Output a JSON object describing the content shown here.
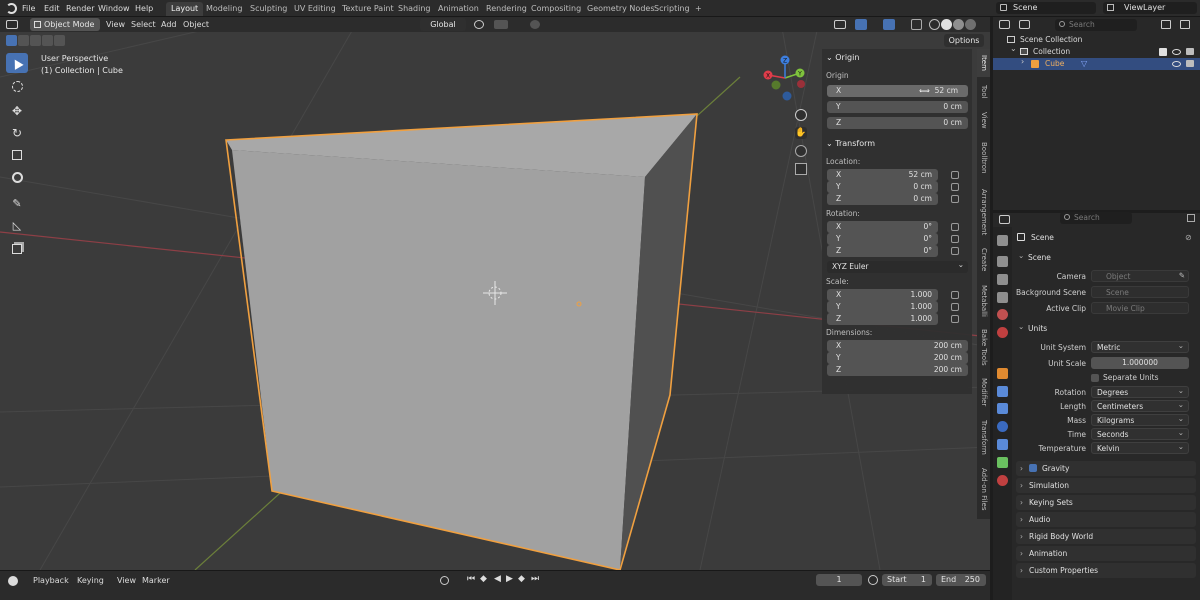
{
  "menubar": {
    "items": [
      "File",
      "Edit",
      "Render",
      "Window",
      "Help"
    ],
    "workspaces": [
      "Layout",
      "Modeling",
      "Sculpting",
      "UV Editing",
      "Texture Paint",
      "Shading",
      "Animation",
      "Rendering",
      "Compositing",
      "Geometry Nodes",
      "Scripting"
    ],
    "active_workspace": "Layout",
    "add_tab": "+",
    "scene_name": "Scene",
    "view_layer": "ViewLayer"
  },
  "viewport_header": {
    "mode": "Object Mode",
    "menus": [
      "View",
      "Select",
      "Add",
      "Object"
    ],
    "orientation": "Global",
    "options_label": "Options"
  },
  "viewport": {
    "perspective": "User Perspective",
    "collection_info": "(1) Collection | Cube",
    "object_color": "#b0b0b0",
    "selection_color": "#f0a040",
    "gizmo": {
      "x_color": "#e03c4a",
      "y_color": "#7fc33d",
      "z_color": "#3d7fe0",
      "labels": [
        "X",
        "Y",
        "Z"
      ]
    }
  },
  "npanel": {
    "origin": {
      "header": "Origin",
      "label": "Origin",
      "x": {
        "axis": "X",
        "value": "52 cm"
      },
      "y": {
        "axis": "Y",
        "value": "0 cm"
      },
      "z": {
        "axis": "Z",
        "value": "0 cm"
      }
    },
    "transform": {
      "header": "Transform",
      "location_label": "Location:",
      "location": [
        {
          "axis": "X",
          "value": "52 cm"
        },
        {
          "axis": "Y",
          "value": "0 cm"
        },
        {
          "axis": "Z",
          "value": "0 cm"
        }
      ],
      "rotation_label": "Rotation:",
      "rotation": [
        {
          "axis": "X",
          "value": "0°"
        },
        {
          "axis": "Y",
          "value": "0°"
        },
        {
          "axis": "Z",
          "value": "0°"
        }
      ],
      "rotation_mode": "XYZ Euler",
      "scale_label": "Scale:",
      "scale": [
        {
          "axis": "X",
          "value": "1.000"
        },
        {
          "axis": "Y",
          "value": "1.000"
        },
        {
          "axis": "Z",
          "value": "1.000"
        }
      ],
      "dimensions_label": "Dimensions:",
      "dimensions": [
        {
          "axis": "X",
          "value": "200 cm"
        },
        {
          "axis": "Y",
          "value": "200 cm"
        },
        {
          "axis": "Z",
          "value": "200 cm"
        }
      ]
    },
    "tabs": [
      "Item",
      "Tool",
      "View",
      "Boolltron",
      "Arrangement",
      "Create",
      "Metaballi",
      "Bake Tools",
      "Modifier",
      "Transform",
      "Add-on Files"
    ]
  },
  "timeline": {
    "menus": [
      "Playback",
      "Keying",
      "View",
      "Marker"
    ],
    "current_frame": "1",
    "start_label": "Start",
    "start": "1",
    "end_label": "End",
    "end": "250"
  },
  "outliner": {
    "search_placeholder": "Search",
    "scene_collection": "Scene Collection",
    "collection": "Collection",
    "object": "Cube"
  },
  "properties": {
    "search_placeholder": "Search",
    "context": "Scene",
    "scene_section": "Scene",
    "camera_label": "Camera",
    "camera_placeholder": "Object",
    "bg_scene_label": "Background Scene",
    "bg_scene_placeholder": "Scene",
    "active_clip_label": "Active Clip",
    "active_clip_placeholder": "Movie Clip",
    "units_section": "Units",
    "unit_system_label": "Unit System",
    "unit_system": "Metric",
    "unit_scale_label": "Unit Scale",
    "unit_scale": "1.000000",
    "separate_units": "Separate Units",
    "rotation_label": "Rotation",
    "rotation": "Degrees",
    "length_label": "Length",
    "length": "Centimeters",
    "mass_label": "Mass",
    "mass": "Kilograms",
    "time_label": "Time",
    "time": "Seconds",
    "temperature_label": "Temperature",
    "temperature": "Kelvin",
    "gravity": "Gravity",
    "sections": [
      "Simulation",
      "Keying Sets",
      "Audio",
      "Rigid Body World",
      "Animation",
      "Custom Properties"
    ]
  }
}
